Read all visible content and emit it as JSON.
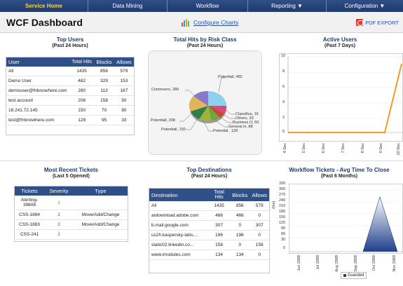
{
  "nav": [
    "Service Home",
    "Data Mining",
    "Workflow",
    "Reporting ▼",
    "Configuration ▼"
  ],
  "header": {
    "title": "WCF Dashboard",
    "configure": "Configure Charts",
    "pdf": "PDF EXPORT"
  },
  "top_users": {
    "title": "Top Users",
    "subtitle": "(Past 24 Hours)",
    "headers": [
      "User",
      "Total Hits",
      "Blocks",
      "Allows"
    ],
    "rows": [
      [
        "All",
        "1435",
        "856",
        "579"
      ],
      [
        "Demo User",
        "482",
        "329",
        "153"
      ],
      [
        "demouser@fnbnowhere.com",
        "280",
        "113",
        "167"
      ],
      [
        "test account",
        "208",
        "158",
        "50"
      ],
      [
        "18.241.72.145",
        "150",
        "70",
        "80"
      ],
      [
        "test@fnbnowhere.com",
        "128",
        "95",
        "33"
      ]
    ]
  },
  "risk": {
    "title": "Total Hits by Risk Class",
    "subtitle": "(Past 24 Hours)",
    "labels": [
      "Potentiall, 482",
      "Controvers, 280",
      "Classifica, 16",
      "Others, 33",
      "Business O, 50",
      "General in, 88",
      "Potential , 128",
      "Potentiall, 150",
      "Potentiall, 208"
    ]
  },
  "active_users": {
    "title": "Active Users",
    "subtitle": "(Past 7 Days)",
    "y_ticks": [
      "10",
      "8",
      "6",
      "4",
      "2",
      "0"
    ],
    "x_ticks": [
      "4 Dec",
      "5 Dec",
      "6 Dec",
      "7 Dec",
      "8 Dec",
      "9 Dec",
      "10 Dec"
    ]
  },
  "tickets": {
    "title": "Most Recent Tickets",
    "subtitle": "(Last 5 Opened)",
    "headers": [
      "Tickets",
      "Severity",
      "Type"
    ],
    "rows": [
      [
        "Alerting-39608",
        "1",
        ""
      ],
      [
        "CSS-1884",
        "2",
        "Move/Add/Change"
      ],
      [
        "CSS-1883",
        "2",
        "Move/Add/Change"
      ],
      [
        "CSS-241",
        "2",
        ""
      ]
    ]
  },
  "destinations": {
    "title": "Top Destinations",
    "subtitle": "(Past 24 Hours)",
    "headers": [
      "Destination",
      "Total Hits",
      "Blocks",
      "Allows"
    ],
    "rows": [
      [
        "All",
        "1435",
        "856",
        "579"
      ],
      [
        "ardownload.adobe.com",
        "466",
        "466",
        "0"
      ],
      [
        "b.mail.google.com",
        "307",
        "0",
        "307"
      ],
      [
        "us2h.kaspersky-labs....",
        "196",
        "196",
        "0"
      ],
      [
        "static02.linkedin.co...",
        "158",
        "0",
        "158"
      ],
      [
        "www.imodules.com",
        "134",
        "134",
        "0"
      ]
    ]
  },
  "workflow": {
    "title": "Workflow Tickets - Avg Time To Close",
    "subtitle": "(Past 6 Months)",
    "ylabel": "(hrs)",
    "y_ticks": [
      "330",
      "300",
      "270",
      "240",
      "210",
      "180",
      "150",
      "120",
      "90",
      "60",
      "30",
      "0"
    ],
    "x_ticks": [
      "Jun 2009",
      "Jul 2009",
      "Aug 2009",
      "Sep 2009",
      "Oct 2009",
      "Nov 2009"
    ],
    "legend": "Guarded"
  },
  "colors": {
    "nav": "#2f4f88",
    "active": "#ffd43b",
    "line": "#f39a2b",
    "area": "#1e3f8c"
  }
}
